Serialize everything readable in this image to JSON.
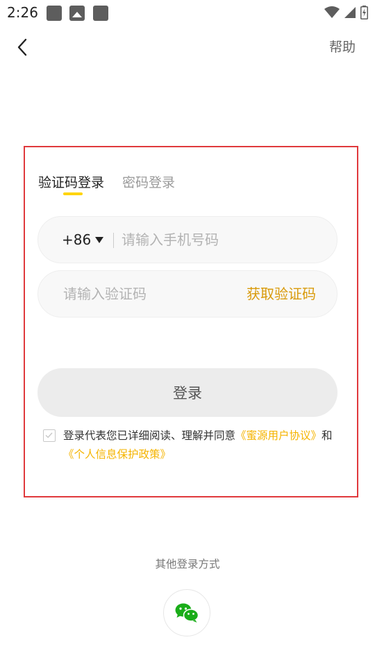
{
  "status_bar": {
    "time": "2:26"
  },
  "header": {
    "help_label": "帮助"
  },
  "tabs": [
    {
      "label": "验证码登录",
      "active": true
    },
    {
      "label": "密码登录",
      "active": false
    }
  ],
  "phone": {
    "country_code": "+86",
    "placeholder": "请输入手机号码",
    "value": ""
  },
  "code": {
    "placeholder": "请输入验证码",
    "value": "",
    "get_code_label": "获取验证码"
  },
  "login_button": "登录",
  "agreement": {
    "checked": false,
    "prefix": "登录代表您已详细阅读、理解并同意",
    "link_user": "《蜜源用户协议》",
    "conjunction": "和",
    "link_privacy": "《个人信息保护政策》"
  },
  "other_login": {
    "title": "其他登录方式",
    "method": "wechat-icon"
  },
  "colors": {
    "accent_yellow": "#ffd400",
    "link_yellow": "#f5b400",
    "get_code": "#d99a0a",
    "wechat_green": "#1aad19",
    "highlight_red": "#e0393c"
  }
}
